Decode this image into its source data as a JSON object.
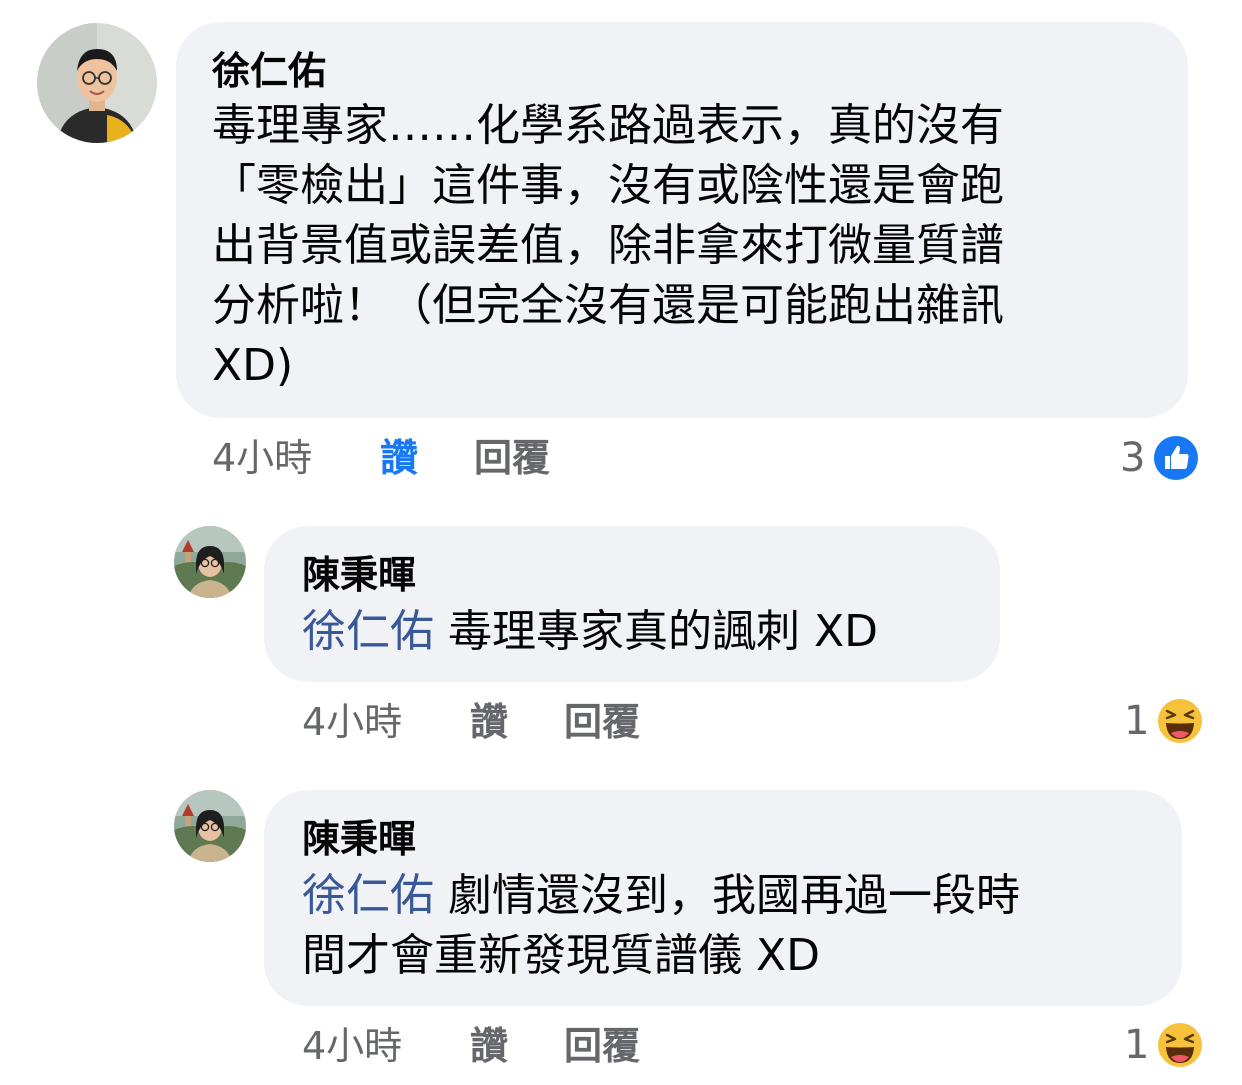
{
  "comments": [
    {
      "author": "徐仁佑",
      "text": "毒理專家……化學系路過表示，真的沒有「零檢出」這件事，沒有或陰性還是會跑出背景值或誤差值，除非拿來打微量質譜分析啦！（但完全沒有還是可能跑出雜訊 XD)",
      "lines": [
        "毒理專家……化學系路過表示，真的沒有",
        "「零檢出」這件事，沒有或陰性還是會跑",
        "出背景值或誤差值，除非拿來打微量質譜",
        "分析啦！（但完全沒有還是可能跑出雜訊",
        "XD)"
      ],
      "time": "4小時",
      "like_label": "讚",
      "reply_label": "回覆",
      "reaction_count": "3",
      "reaction_icon": "like-icon"
    },
    {
      "author": "陳秉暉",
      "mention": "徐仁佑",
      "text": "毒理專家真的諷刺 XD",
      "time": "4小時",
      "like_label": "讚",
      "reply_label": "回覆",
      "reaction_count": "1",
      "reaction_icon": "haha-icon"
    },
    {
      "author": "陳秉暉",
      "mention": "徐仁佑",
      "line1": "劇情還沒到，我國再過一段時",
      "line2": "間才會重新發現質譜儀 XD",
      "time": "4小時",
      "like_label": "讚",
      "reply_label": "回覆",
      "reaction_count": "1",
      "reaction_icon": "haha-icon"
    }
  ],
  "colors": {
    "bubble_bg": "#f0f2f5",
    "mention": "#385898",
    "like_active": "#1877f2",
    "meta": "#65676b"
  }
}
